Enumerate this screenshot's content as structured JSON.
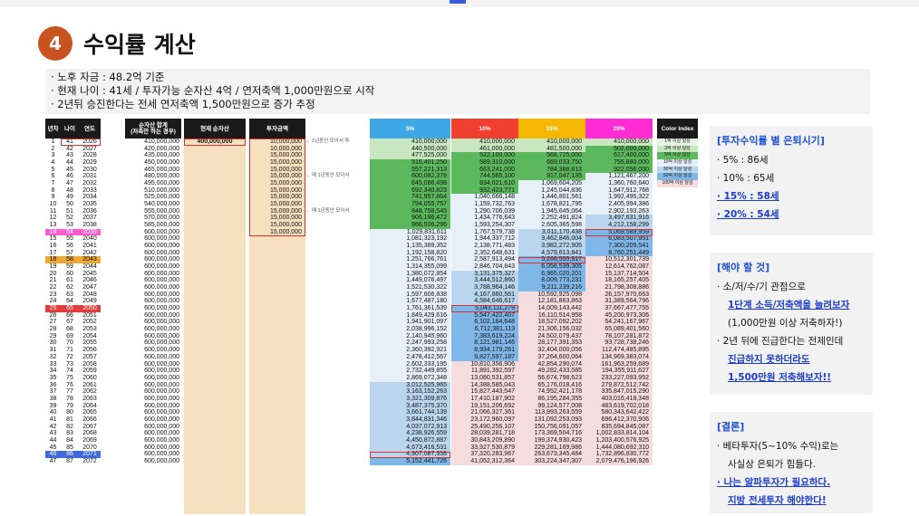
{
  "title": {
    "number": "4",
    "text": "수익률 계산"
  },
  "notes": [
    "· 노후 자금 : 48.2억 기준",
    "· 현재 나이 : 41세 / 투자가능 순자산 4억 / 연저축액 1,000만원으로 시작",
    "· 2년뒤 승진한다는 전세 연저축액 1,500만원으로 증가 추정"
  ],
  "sheet": {
    "headers": {
      "n": "년차",
      "age": "나이",
      "year": "연도",
      "total": "순자산 합계\n(저축만 하는 경우)",
      "asset": "현재 순자산",
      "save": "투자금액",
      "r5": "5%",
      "r10": "10%",
      "r15": "15%",
      "r20": "20%",
      "legend": "Color Index"
    },
    "colors": {
      "r5": "#3fa7e6",
      "r10": "#f03f2e",
      "r15": "#f5b800",
      "r20": "#ff2bd3",
      "legend": "#1a1a1a"
    },
    "legend": [
      {
        "label": "1억 이상 달성",
        "color": "#e7f3e3"
      },
      {
        "label": "3억 이상 달성",
        "color": "#c8e6c0"
      },
      {
        "label": "5억 이상 달성",
        "color": "#5cb85c"
      },
      {
        "label": "10억 이상 달성",
        "color": "#e7f0f8"
      },
      {
        "label": "30억 이상 달성",
        "color": "#b9d6ee"
      },
      {
        "label": "50억 이상 달성",
        "color": "#7fb8e8"
      },
      {
        "label": "100억 이상 달성",
        "color": "#f6dcdc"
      }
    ],
    "notes": {
      "r1": "← 1년동안 모아서 투",
      "r6": "← 매 1년동안 모아서",
      "r11": "← 매 1년동안 모아서"
    },
    "rows": [
      [
        "1",
        "41",
        "2026",
        "410,000,000",
        "400,000,000",
        "10,000,000",
        "410,000,000",
        "410,000,000",
        "410,000,000",
        "410,000,000"
      ],
      [
        "2",
        "42",
        "2027",
        "420,000,000",
        "",
        "10,000,000",
        "440,500,000",
        "461,000,000",
        "481,500,000",
        "502,000,000"
      ],
      [
        "3",
        "43",
        "2028",
        "435,000,000",
        "",
        "15,000,000",
        "477,525,000",
        "522,100,000",
        "568,725,000",
        "617,400,000"
      ],
      [
        "4",
        "44",
        "2029",
        "450,000,000",
        "",
        "15,000,000",
        "516,401,250",
        "589,310,000",
        "669,033,750",
        "755,880,000"
      ],
      [
        "5",
        "45",
        "2030",
        "465,000,000",
        "",
        "15,000,000",
        "557,221,313",
        "663,241,000",
        "784,388,813",
        "922,056,000"
      ],
      [
        "6",
        "46",
        "2031",
        "480,000,000",
        "",
        "15,000,000",
        "600,082,379",
        "744,565,100",
        "917,047,135",
        "1,121,467,200"
      ],
      [
        "7",
        "47",
        "2032",
        "495,000,000",
        "",
        "15,000,000",
        "645,086,498",
        "834,021,610",
        "1,069,604,205",
        "1,360,760,640"
      ],
      [
        "8",
        "48",
        "2033",
        "510,000,000",
        "",
        "15,000,000",
        "692,340,823",
        "932,423,771",
        "1,245,044,836",
        "1,647,912,768"
      ],
      [
        "9",
        "49",
        "2034",
        "525,000,000",
        "",
        "15,000,000",
        "741,957,864",
        "1,040,666,148",
        "1,446,801,561",
        "1,992,495,322"
      ],
      [
        "10",
        "50",
        "2035",
        "540,000,000",
        "",
        "15,000,000",
        "794,055,757",
        "1,159,732,763",
        "1,678,821,795",
        "2,405,994,386"
      ],
      [
        "11",
        "51",
        "2036",
        "555,000,000",
        "",
        "15,000,000",
        "848,758,545",
        "1,290,706,039",
        "1,945,645,064",
        "2,902,193,263"
      ],
      [
        "12",
        "52",
        "2037",
        "570,000,000",
        "",
        "15,000,000",
        "906,196,472",
        "1,434,776,643",
        "2,252,491,824",
        "3,497,631,916"
      ],
      [
        "13",
        "53",
        "2038",
        "585,000,000",
        "",
        "15,000,000",
        "966,506,296",
        "1,593,254,307",
        "2,605,365,598",
        "4,212,158,299"
      ],
      [
        "14",
        "54",
        "2039",
        "600,000,000",
        "",
        "15,000,000",
        "1,029,831,611",
        "1,767,579,738",
        "3,011,170,438",
        "5,069,589,959"
      ],
      [
        "15",
        "55",
        "2040",
        "600,000,000",
        "",
        "",
        "1,081,323,192",
        "1,944,337,712",
        "3,462,846,004",
        "6,083,507,951"
      ],
      [
        "16",
        "56",
        "2041",
        "600,000,000",
        "",
        "",
        "1,135,389,352",
        "2,138,771,483",
        "3,982,272,905",
        "7,300,209,541"
      ],
      [
        "17",
        "57",
        "2042",
        "600,000,000",
        "",
        "",
        "1,192,158,820",
        "2,352,648,631",
        "4,579,613,841",
        "8,760,251,449"
      ],
      [
        "18",
        "58",
        "2043",
        "600,000,000",
        "",
        "",
        "1,251,766,761",
        "2,587,913,494",
        "5,266,555,917",
        "10,512,301,739"
      ],
      [
        "19",
        "59",
        "2044",
        "600,000,000",
        "",
        "",
        "1,314,355,099",
        "2,846,704,843",
        "6,056,539,305",
        "12,614,762,087"
      ],
      [
        "20",
        "60",
        "2045",
        "600,000,000",
        "",
        "",
        "1,380,072,854",
        "3,131,375,327",
        "6,965,020,201",
        "15,137,714,504"
      ],
      [
        "21",
        "61",
        "2046",
        "600,000,000",
        "",
        "",
        "1,449,076,497",
        "3,444,512,860",
        "8,009,773,231",
        "18,165,257,405"
      ],
      [
        "22",
        "62",
        "2047",
        "600,000,000",
        "",
        "",
        "1,521,530,322",
        "3,788,964,146",
        "9,211,239,216",
        "21,798,308,886"
      ],
      [
        "23",
        "63",
        "2048",
        "600,000,000",
        "",
        "",
        "1,597,606,838",
        "4,167,860,561",
        "10,592,925,098",
        "26,157,970,663"
      ],
      [
        "24",
        "64",
        "2049",
        "600,000,000",
        "",
        "",
        "1,677,487,180",
        "4,584,646,617",
        "12,181,863,863",
        "31,389,564,796"
      ],
      [
        "25",
        "65",
        "2050",
        "600,000,000",
        "",
        "",
        "1,761,361,539",
        "5,043,111,279",
        "14,009,143,442",
        "37,667,477,755"
      ],
      [
        "26",
        "66",
        "2051",
        "600,000,000",
        "",
        "",
        "1,849,429,616",
        "5,547,422,407",
        "16,110,514,958",
        "45,200,973,306"
      ],
      [
        "27",
        "67",
        "2052",
        "600,000,000",
        "",
        "",
        "1,941,901,097",
        "6,102,164,648",
        "18,527,092,202",
        "54,241,167,967"
      ],
      [
        "28",
        "68",
        "2053",
        "600,000,000",
        "",
        "",
        "2,038,996,152",
        "6,712,381,113",
        "21,306,156,032",
        "65,089,401,560"
      ],
      [
        "29",
        "69",
        "2054",
        "600,000,000",
        "",
        "",
        "2,140,945,960",
        "7,383,619,224",
        "24,502,079,437",
        "78,107,281,872"
      ],
      [
        "30",
        "70",
        "2055",
        "600,000,000",
        "",
        "",
        "2,247,993,258",
        "8,121,981,146",
        "28,177,391,353",
        "93,728,738,246"
      ],
      [
        "31",
        "71",
        "2056",
        "600,000,000",
        "",
        "",
        "2,360,392,921",
        "8,934,179,261",
        "32,404,000,056",
        "112,474,485,895"
      ],
      [
        "32",
        "72",
        "2057",
        "600,000,000",
        "",
        "",
        "2,478,412,567",
        "9,827,597,187",
        "37,264,600,064",
        "134,969,383,074"
      ],
      [
        "33",
        "73",
        "2058",
        "600,000,000",
        "",
        "",
        "2,602,333,195",
        "10,810,356,906",
        "42,854,290,074",
        "161,963,259,689"
      ],
      [
        "34",
        "74",
        "2059",
        "600,000,000",
        "",
        "",
        "2,732,449,855",
        "11,891,392,597",
        "49,282,433,585",
        "194,355,911,627"
      ],
      [
        "35",
        "75",
        "2060",
        "600,000,000",
        "",
        "",
        "2,869,072,348",
        "13,080,531,857",
        "56,674,798,623",
        "233,227,093,952"
      ],
      [
        "36",
        "76",
        "2061",
        "600,000,000",
        "",
        "",
        "3,012,525,965",
        "14,388,585,043",
        "65,176,018,416",
        "279,872,512,742"
      ],
      [
        "37",
        "77",
        "2062",
        "600,000,000",
        "",
        "",
        "3,163,152,263",
        "15,827,443,547",
        "74,952,421,178",
        "335,847,015,290"
      ],
      [
        "38",
        "78",
        "2063",
        "600,000,000",
        "",
        "",
        "3,321,309,876",
        "17,410,187,902",
        "86,195,284,355",
        "403,016,418,348"
      ],
      [
        "39",
        "79",
        "2064",
        "600,000,000",
        "",
        "",
        "3,487,375,370",
        "19,151,206,692",
        "99,124,577,008",
        "483,619,702,018"
      ],
      [
        "40",
        "80",
        "2065",
        "600,000,000",
        "",
        "",
        "3,661,744,139",
        "21,066,327,361",
        "113,993,263,559",
        "580,343,642,422"
      ],
      [
        "41",
        "81",
        "2066",
        "600,000,000",
        "",
        "",
        "3,844,831,346",
        "23,172,960,097",
        "131,092,253,093",
        "696,412,370,906"
      ],
      [
        "42",
        "82",
        "2067",
        "600,000,000",
        "",
        "",
        "4,037,072,913",
        "25,490,256,107",
        "150,756,091,057",
        "835,694,845,087"
      ],
      [
        "43",
        "83",
        "2068",
        "600,000,000",
        "",
        "",
        "4,238,926,559",
        "28,039,281,718",
        "173,369,504,716",
        "1,002,833,814,104"
      ],
      [
        "44",
        "84",
        "2069",
        "600,000,000",
        "",
        "",
        "4,450,872,887",
        "30,843,209,890",
        "199,374,930,423",
        "1,203,400,576,925"
      ],
      [
        "45",
        "85",
        "2070",
        "600,000,000",
        "",
        "",
        "4,673,416,531",
        "33,927,530,879",
        "229,281,169,986",
        "1,444,080,692,310"
      ],
      [
        "46",
        "86",
        "2071",
        "600,000,000",
        "",
        "",
        "4,907,087,358",
        "37,320,283,967",
        "263,673,345,484",
        "1,732,896,830,772"
      ],
      [
        "47",
        "87",
        "2072",
        "600,000,000",
        "",
        "",
        "5,152,441,726",
        "41,052,312,364",
        "303,224,347,307",
        "2,079,476,196,926"
      ]
    ]
  },
  "panels": {
    "retire": {
      "heading": "[투자수익률 별 은퇴시기]",
      "lines": [
        "· 5% : 86세",
        "· 10% : 65세",
        "· 15% : 58세",
        "· 20% : 54세"
      ]
    },
    "todo": {
      "heading": "[해야 할 것]",
      "lines": [
        "· 소/저/수/기 관점으로",
        "1단계 소득/저축액을 늘려보자",
        "(1,000만원 이상 저축하자!)",
        "· 2년 뒤에 진급한다는 전제인데",
        "진급하지 못하더라도",
        "1,500만원 저축해보자!!"
      ]
    },
    "conclusion": {
      "heading": "[결론]",
      "lines": [
        "· 베타투자(5~10% 수익)로는",
        "사실상 은퇴가 힘들다.",
        "· 나는 알파투자가 필요하다.",
        "지방 전세투자 해야한다!"
      ]
    }
  }
}
